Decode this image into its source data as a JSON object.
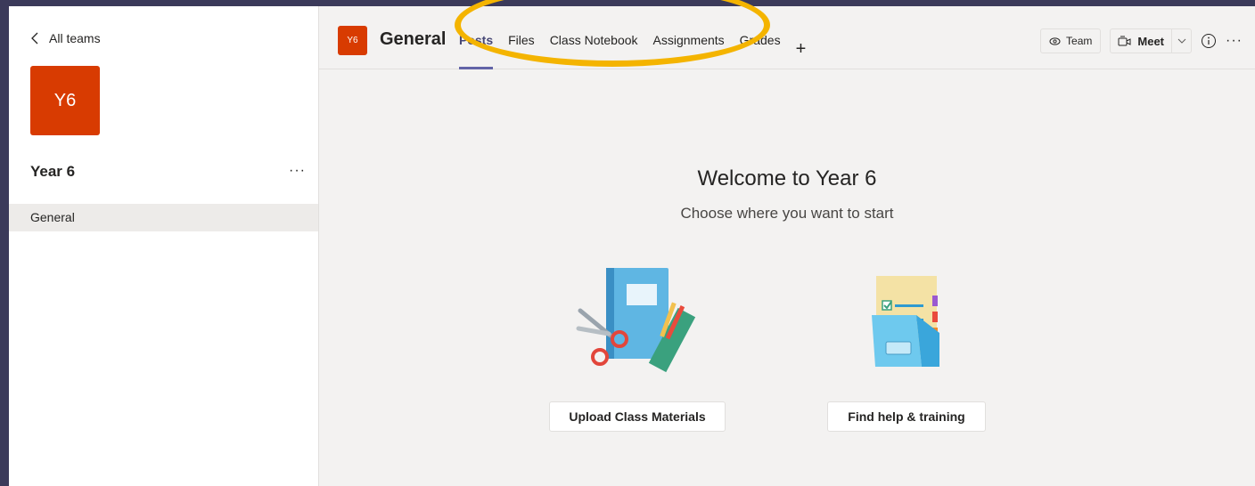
{
  "sidebar": {
    "back_label": "All teams",
    "team_initials": "Y6",
    "team_name": "Year 6",
    "more": "···",
    "channels": [
      {
        "label": "General"
      }
    ]
  },
  "header": {
    "channel_initials": "Y6",
    "channel_title": "General",
    "tabs": [
      {
        "label": "Posts",
        "active": true
      },
      {
        "label": "Files"
      },
      {
        "label": "Class Notebook"
      },
      {
        "label": "Assignments"
      },
      {
        "label": "Grades"
      }
    ],
    "add_tab": "+",
    "team_label": "Team",
    "meet_label": "Meet",
    "more": "···"
  },
  "content": {
    "welcome": "Welcome to Year 6",
    "subtitle": "Choose where you want to start",
    "upload_label": "Upload Class Materials",
    "help_label": "Find help & training"
  },
  "colors": {
    "team_avatar": "#d83b01",
    "active_tab": "#6264a7",
    "highlight_ring": "#f4b400"
  }
}
